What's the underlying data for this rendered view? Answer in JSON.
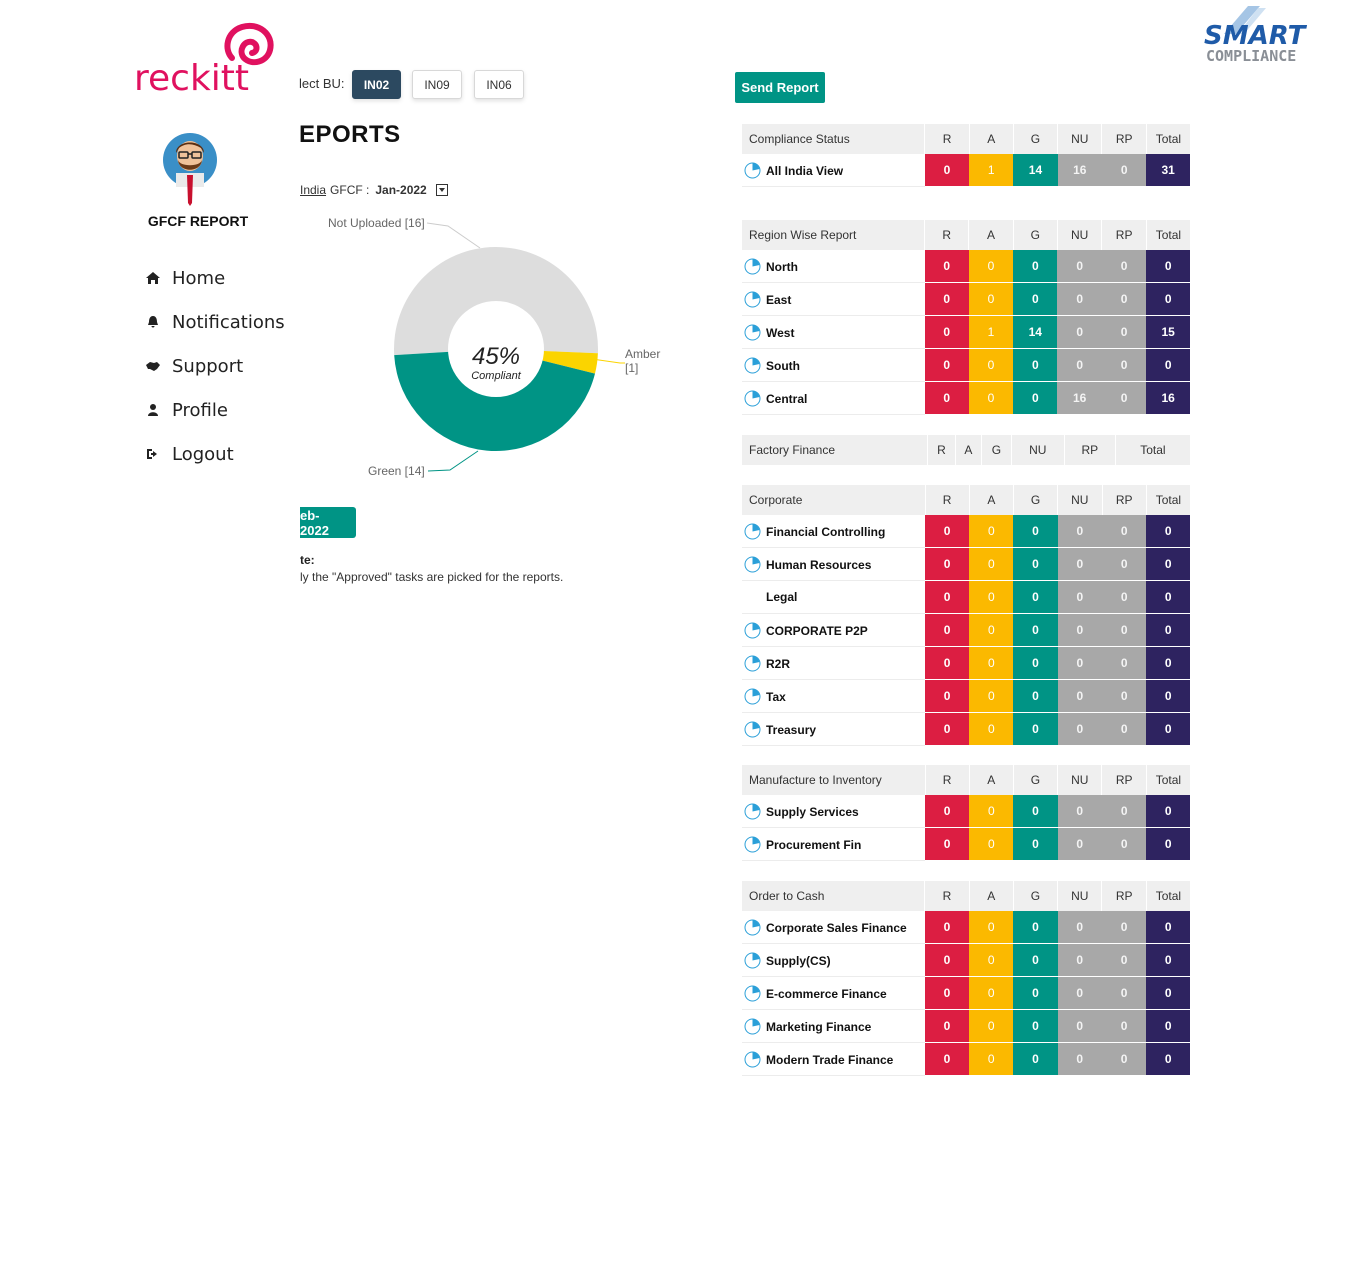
{
  "brand": {
    "company": "reckitt",
    "product_top": "SMART",
    "product_bottom": "COMPLIANCE"
  },
  "sidebar": {
    "app_title": "GFCF REPORT",
    "nav": [
      {
        "label": "Home",
        "icon": "home-icon"
      },
      {
        "label": "Notifications",
        "icon": "bell-icon"
      },
      {
        "label": "Support",
        "icon": "handshake-icon"
      },
      {
        "label": "Profile",
        "icon": "user-icon"
      },
      {
        "label": "Logout",
        "icon": "logout-icon"
      }
    ]
  },
  "bu": {
    "label": "lect BU:",
    "options": [
      "IN02",
      "IN09",
      "IN06"
    ],
    "selected": "IN02"
  },
  "report": {
    "heading": "EPORTS",
    "filter": {
      "region": "India",
      "type": "GFCF :",
      "month": "Jan-2022"
    },
    "next_month_button": "eb-2022",
    "note_title": "te:",
    "note_text": "ly the \"Approved\" tasks are picked for the reports."
  },
  "donut": {
    "center_value": "45%",
    "center_label": "Compliant",
    "slices": [
      {
        "name": "Not Uploaded",
        "label": "Not Uploaded [16]",
        "value": 16,
        "color": "#dddddd"
      },
      {
        "name": "Amber",
        "label": "Amber",
        "label2": "[1]",
        "value": 1,
        "color": "#fbd400"
      },
      {
        "name": "Green",
        "label": "Green [14]",
        "value": 14,
        "color": "#009485"
      }
    ]
  },
  "send_report_label": "Send Report",
  "colors": {
    "R": "#dc1e42",
    "A": "#fbb900",
    "G": "#009485",
    "NU": "#a8a8a8",
    "RP": "#a8a8a8",
    "Total": "#2e2360"
  },
  "columns": [
    "R",
    "A",
    "G",
    "NU",
    "RP",
    "Total"
  ],
  "tables": [
    {
      "title": "Compliance Status",
      "rows": [
        {
          "name": "All India View",
          "icon": true,
          "values": [
            0,
            1,
            14,
            16,
            0,
            31
          ]
        }
      ]
    },
    {
      "title": "Region Wise Report",
      "rows": [
        {
          "name": "North",
          "icon": true,
          "values": [
            0,
            0,
            0,
            0,
            0,
            0
          ]
        },
        {
          "name": "East",
          "icon": true,
          "values": [
            0,
            0,
            0,
            0,
            0,
            0
          ]
        },
        {
          "name": "West",
          "icon": true,
          "values": [
            0,
            1,
            14,
            0,
            0,
            15
          ]
        },
        {
          "name": "South",
          "icon": true,
          "values": [
            0,
            0,
            0,
            0,
            0,
            0
          ]
        },
        {
          "name": "Central",
          "icon": true,
          "values": [
            0,
            0,
            0,
            16,
            0,
            16
          ]
        }
      ]
    },
    {
      "title": "Factory Finance",
      "rows": []
    },
    {
      "title": "Corporate",
      "rows": [
        {
          "name": "Financial Controlling",
          "icon": true,
          "values": [
            0,
            0,
            0,
            0,
            0,
            0
          ]
        },
        {
          "name": "Human Resources",
          "icon": true,
          "values": [
            0,
            0,
            0,
            0,
            0,
            0
          ]
        },
        {
          "name": "Legal",
          "icon": false,
          "values": [
            0,
            0,
            0,
            0,
            0,
            0
          ]
        },
        {
          "name": "CORPORATE P2P",
          "icon": true,
          "values": [
            0,
            0,
            0,
            0,
            0,
            0
          ]
        },
        {
          "name": "R2R",
          "icon": true,
          "values": [
            0,
            0,
            0,
            0,
            0,
            0
          ]
        },
        {
          "name": "Tax",
          "icon": true,
          "values": [
            0,
            0,
            0,
            0,
            0,
            0
          ]
        },
        {
          "name": "Treasury",
          "icon": true,
          "values": [
            0,
            0,
            0,
            0,
            0,
            0
          ]
        }
      ]
    },
    {
      "title": "Manufacture to Inventory",
      "rows": [
        {
          "name": "Supply Services",
          "icon": true,
          "values": [
            0,
            0,
            0,
            0,
            0,
            0
          ]
        },
        {
          "name": "Procurement Fin",
          "icon": true,
          "values": [
            0,
            0,
            0,
            0,
            0,
            0
          ]
        }
      ]
    },
    {
      "title": "Order to Cash",
      "rows": [
        {
          "name": "Corporate Sales Finance",
          "icon": true,
          "values": [
            0,
            0,
            0,
            0,
            0,
            0
          ]
        },
        {
          "name": "Supply(CS)",
          "icon": true,
          "values": [
            0,
            0,
            0,
            0,
            0,
            0
          ]
        },
        {
          "name": "E-commerce Finance",
          "icon": true,
          "values": [
            0,
            0,
            0,
            0,
            0,
            0
          ]
        },
        {
          "name": "Marketing Finance",
          "icon": true,
          "values": [
            0,
            0,
            0,
            0,
            0,
            0
          ]
        },
        {
          "name": "Modern Trade Finance",
          "icon": true,
          "values": [
            0,
            0,
            0,
            0,
            0,
            0
          ]
        }
      ]
    }
  ]
}
